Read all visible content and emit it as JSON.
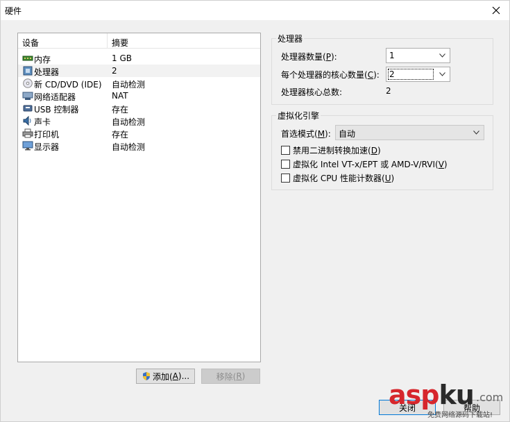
{
  "window": {
    "title": "硬件"
  },
  "device_list": {
    "columns": [
      "设备",
      "摘要"
    ],
    "rows": [
      {
        "icon": "memory-icon",
        "name": "内存",
        "summary": "1 GB"
      },
      {
        "icon": "processor-icon",
        "name": "处理器",
        "summary": "2"
      },
      {
        "icon": "cd-dvd-icon",
        "name": "新 CD/DVD (IDE)",
        "summary": "自动检测"
      },
      {
        "icon": "network-adapter-icon",
        "name": "网络适配器",
        "summary": "NAT"
      },
      {
        "icon": "usb-icon",
        "name": "USB 控制器",
        "summary": "存在"
      },
      {
        "icon": "sound-card-icon",
        "name": "声卡",
        "summary": "自动检测"
      },
      {
        "icon": "printer-icon",
        "name": "打印机",
        "summary": "存在"
      },
      {
        "icon": "display-icon",
        "name": "显示器",
        "summary": "自动检测"
      }
    ],
    "selected": "处理器"
  },
  "buttons": {
    "add": {
      "prefix": "添加(",
      "key": "A",
      "suffix": ")..."
    },
    "remove": {
      "prefix": "移除(",
      "key": "R",
      "suffix": ")"
    },
    "close": {
      "label": "关闭"
    },
    "help": {
      "label": "帮助"
    }
  },
  "processors": {
    "group_title": "处理器",
    "count_label": {
      "prefix": "处理器数量(",
      "key": "P",
      "suffix": "):"
    },
    "count_value": "1",
    "cores_label": {
      "prefix": "每个处理器的核心数量(",
      "key": "C",
      "suffix": "):"
    },
    "cores_value": "2",
    "total_label": "处理器核心总数:",
    "total_value": "2"
  },
  "virtualization": {
    "group_title": "虚拟化引擎",
    "mode_label": {
      "prefix": "首选模式(",
      "key": "M",
      "suffix": "):"
    },
    "mode_value": "自动",
    "options": [
      {
        "prefix": "禁用二进制转换加速(",
        "key": "D",
        "suffix": ")",
        "checked": false
      },
      {
        "prefix": "虚拟化 Intel VT-x/EPT 或 AMD-V/RVI(",
        "key": "V",
        "suffix": ")",
        "checked": false
      },
      {
        "prefix": "虚拟化 CPU 性能计数器(",
        "key": "U",
        "suffix": ")",
        "checked": false
      }
    ]
  },
  "watermark": {
    "main_a": "asp",
    "main_b": "ku",
    "suffix": ".com",
    "sub": "免费网络源码下载站!"
  }
}
